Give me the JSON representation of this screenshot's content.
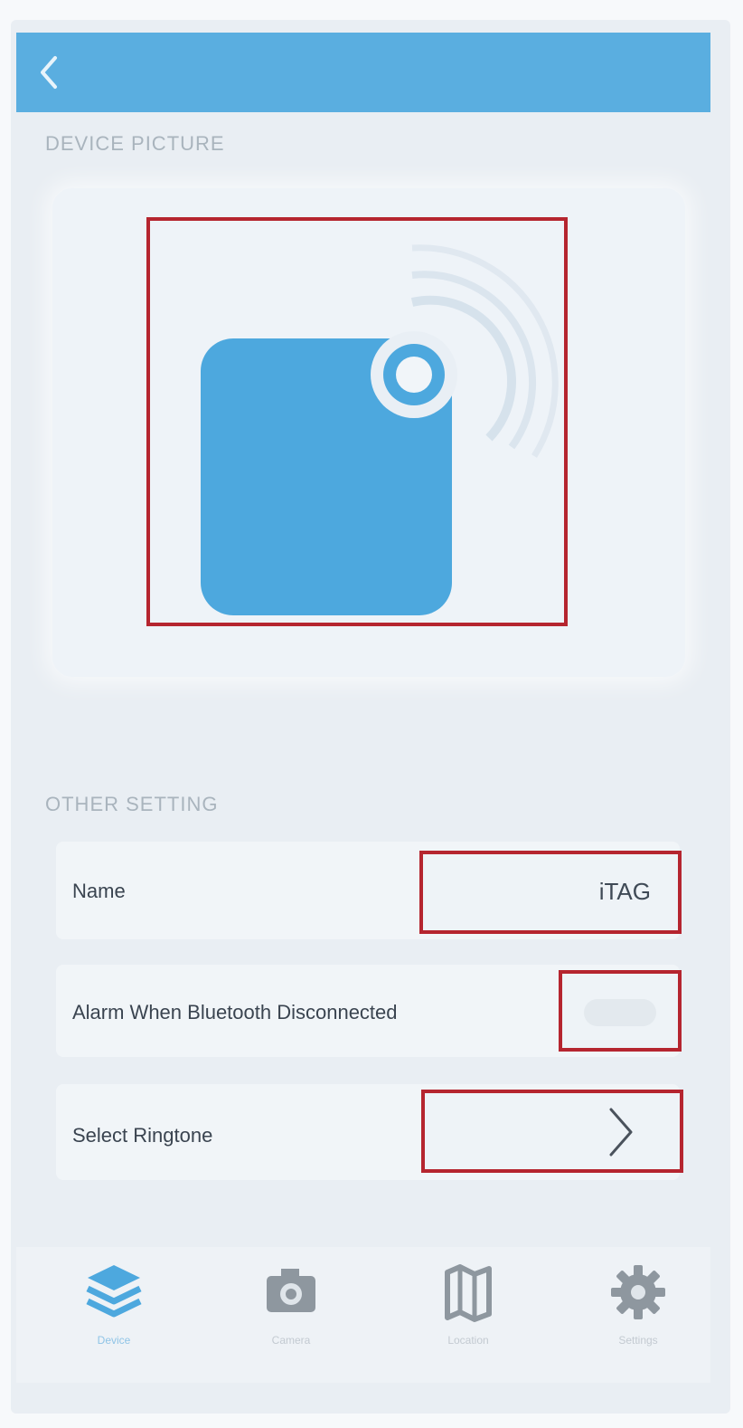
{
  "colors": {
    "header": "#5aaee0",
    "accent": "#4da8de",
    "highlight_border": "#b5252f",
    "inactive_icon": "#9aa3ab"
  },
  "header": {
    "back_icon": "chevron-left-icon"
  },
  "sections": {
    "picture_title": "DEVICE PICTURE",
    "settings_title": "OTHER SETTING"
  },
  "device_picture": {
    "icon": "bluetooth-tag-icon"
  },
  "settings": {
    "name_label": "Name",
    "name_value": "iTAG",
    "alarm_label": "Alarm When Bluetooth Disconnected",
    "alarm_enabled": false,
    "ringtone_label": "Select Ringtone",
    "ringtone_icon": "chevron-right-icon"
  },
  "tabbar": {
    "tabs": [
      {
        "label": "Device",
        "icon": "layers-icon",
        "active": true
      },
      {
        "label": "Camera",
        "icon": "camera-icon",
        "active": false
      },
      {
        "label": "Location",
        "icon": "map-icon",
        "active": false
      },
      {
        "label": "Settings",
        "icon": "gear-icon",
        "active": false
      }
    ]
  }
}
